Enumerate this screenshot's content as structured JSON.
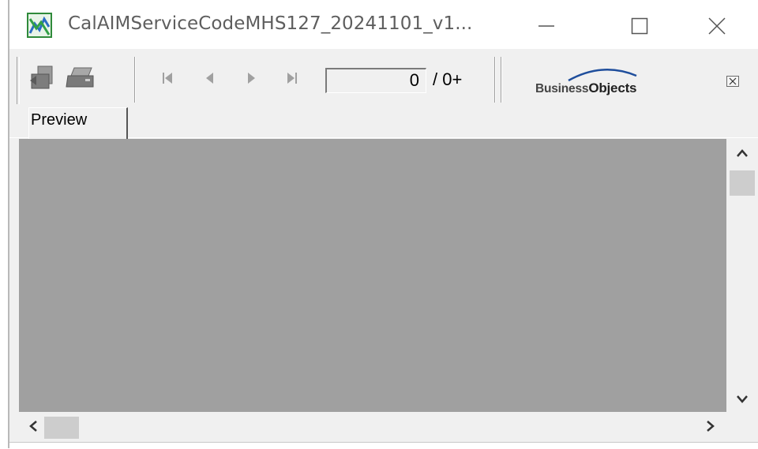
{
  "window": {
    "title": "CalAIMServiceCodeMHS127_20241101_v1...",
    "controls": [
      "minimize",
      "maximize",
      "close"
    ]
  },
  "toolbar": {
    "buttons": [
      {
        "name": "export-icon",
        "interactable": true
      },
      {
        "name": "print-icon",
        "interactable": true
      },
      {
        "name": "first-page-icon",
        "interactable": true
      },
      {
        "name": "previous-page-icon",
        "interactable": true
      },
      {
        "name": "next-page-icon",
        "interactable": true
      },
      {
        "name": "last-page-icon",
        "interactable": true
      }
    ],
    "current_page": "0",
    "page_total": "/ 0+",
    "logo": {
      "business": "Business",
      "objects": "Objects"
    }
  },
  "tabs": [
    {
      "label": "Preview",
      "selected": true
    }
  ],
  "colors": {
    "preview_background": "#a0a0a0",
    "chrome": "#f0f0f0",
    "scroll_thumb": "#cdcdcd"
  }
}
